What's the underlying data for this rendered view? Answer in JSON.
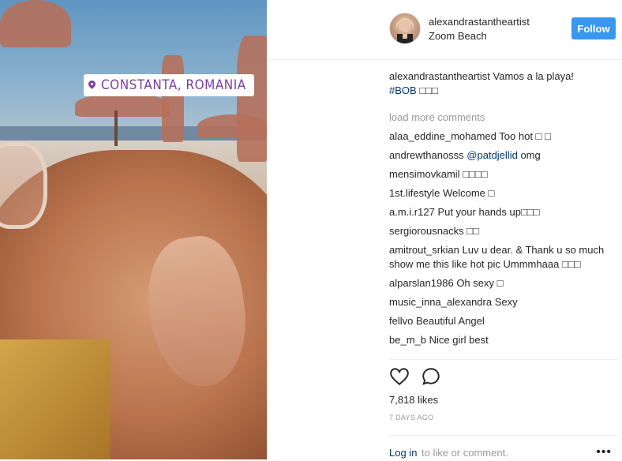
{
  "post": {
    "sticker_text": "CONSTANTA, ROMANIA",
    "username": "alexandrastantheartist",
    "location": "Zoom Beach",
    "follow_label": "Follow",
    "caption_user": "alexandrastantheartist",
    "caption_text": "Vamos a la playa!",
    "caption_tag": "#BOB",
    "caption_emoji": "□□□",
    "load_more": "load more comments",
    "likes": "7,818 likes",
    "time": "7 DAYS AGO",
    "login_link": "Log in",
    "login_rest": "to like or comment.",
    "more_dots": "•••"
  },
  "comments": [
    {
      "user": "alaa_eddine_mohamed",
      "text": "Too hot □ □"
    },
    {
      "user": "andrewthanosss",
      "mention": "@patdjellid",
      "text": "omg"
    },
    {
      "user": "mensimovkamil",
      "text": "□□□□"
    },
    {
      "user": "1st.lifestyle",
      "text": "Welcome □"
    },
    {
      "user": "a.m.i.r127",
      "text": "Put your hands up□□□"
    },
    {
      "user": "sergiorousnacks",
      "text": "□□"
    },
    {
      "user": "amitrout_srkian",
      "text": "Luv u dear. & Thank u so much show me this like hot pic Ummmhaaa □□□"
    },
    {
      "user": "alparslan1986",
      "text": "Oh sexy □"
    },
    {
      "user": "music_inna_alexandra",
      "text": "Sexy"
    },
    {
      "user": "fellvo",
      "text": "Beautiful Angel"
    },
    {
      "user": "be_m_b",
      "text": "Nice girl best"
    }
  ],
  "colors": {
    "follow": "#3897f0",
    "link": "#003569",
    "muted": "#999999",
    "sticker": "#7a3fa3"
  },
  "icons": {
    "heart": "heart-icon",
    "comment": "comment-icon",
    "pin": "location-pin-icon",
    "more": "more-options-icon"
  }
}
